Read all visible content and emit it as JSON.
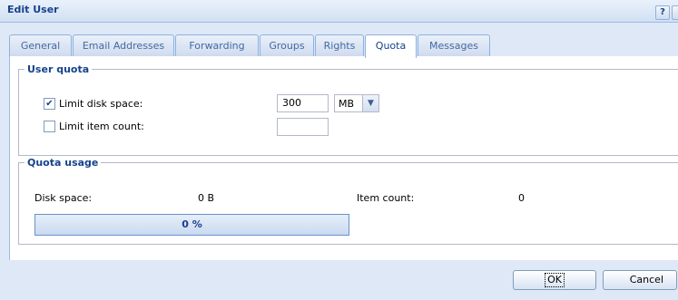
{
  "window": {
    "title": "Edit User",
    "help_label": "?"
  },
  "tabs": [
    {
      "label": "General",
      "active": false
    },
    {
      "label": "Email Addresses",
      "active": false
    },
    {
      "label": "Forwarding",
      "active": false
    },
    {
      "label": "Groups",
      "active": false
    },
    {
      "label": "Rights",
      "active": false
    },
    {
      "label": "Quota",
      "active": true
    },
    {
      "label": "Messages",
      "active": false
    }
  ],
  "user_quota": {
    "legend": "User quota",
    "limit_disk": {
      "label": "Limit disk space:",
      "checked": true,
      "value": "300",
      "unit": "MB"
    },
    "limit_items": {
      "label": "Limit item count:",
      "checked": false,
      "value": ""
    }
  },
  "quota_usage": {
    "legend": "Quota usage",
    "disk_label": "Disk space:",
    "disk_value": "0 B",
    "items_label": "Item count:",
    "items_value": "0",
    "progress_text": "0 %",
    "progress_fraction": 0
  },
  "footer": {
    "ok_label": "OK",
    "cancel_label": "Cancel"
  },
  "colors": {
    "window_bg": "#dfe8f6",
    "title_text": "#15428b",
    "border": "#99bbe8"
  },
  "icons": {
    "help": "help-icon",
    "close": "close-icon",
    "dropdown": "chevron-down-icon",
    "check": "checkmark-icon"
  }
}
